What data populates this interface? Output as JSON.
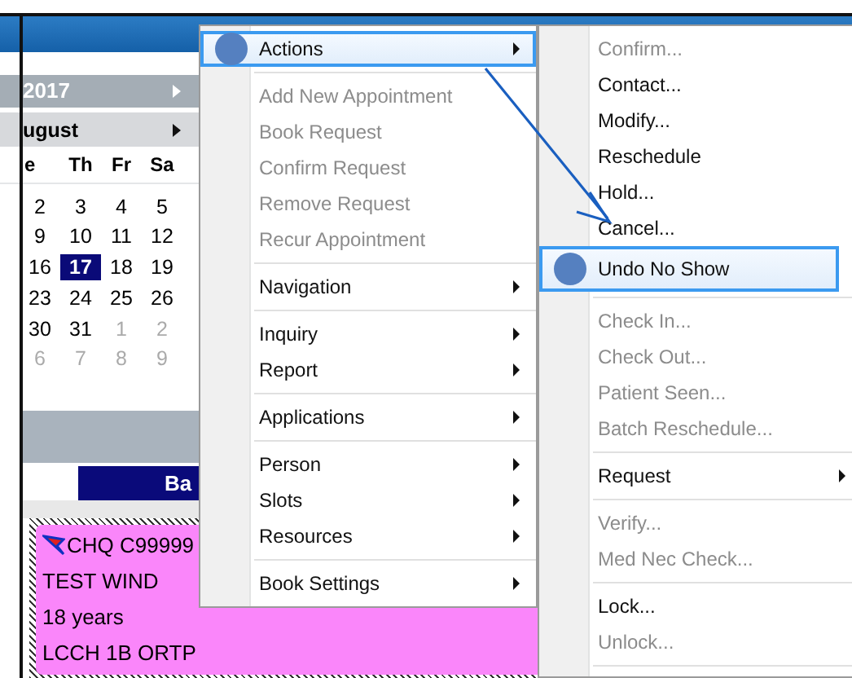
{
  "calendar": {
    "year": "2017",
    "month": "ugust",
    "weekdays": [
      "e",
      "Th",
      "Fr",
      "Sa"
    ],
    "weeks": [
      [
        {
          "day": "2",
          "other_month": false,
          "selected": false
        },
        {
          "day": "3",
          "other_month": false,
          "selected": false
        },
        {
          "day": "4",
          "other_month": false,
          "selected": false
        },
        {
          "day": "5",
          "other_month": false,
          "selected": false
        }
      ],
      [
        {
          "day": "9",
          "other_month": false,
          "selected": false
        },
        {
          "day": "10",
          "other_month": false,
          "selected": false
        },
        {
          "day": "11",
          "other_month": false,
          "selected": false
        },
        {
          "day": "12",
          "other_month": false,
          "selected": false
        }
      ],
      [
        {
          "day": "16",
          "other_month": false,
          "selected": false
        },
        {
          "day": "17",
          "other_month": false,
          "selected": true
        },
        {
          "day": "18",
          "other_month": false,
          "selected": false
        },
        {
          "day": "19",
          "other_month": false,
          "selected": false
        }
      ],
      [
        {
          "day": "23",
          "other_month": false,
          "selected": false
        },
        {
          "day": "24",
          "other_month": false,
          "selected": false
        },
        {
          "day": "25",
          "other_month": false,
          "selected": false
        },
        {
          "day": "26",
          "other_month": false,
          "selected": false
        }
      ],
      [
        {
          "day": "30",
          "other_month": false,
          "selected": false
        },
        {
          "day": "31",
          "other_month": false,
          "selected": false
        },
        {
          "day": "1",
          "other_month": true,
          "selected": false
        },
        {
          "day": "2",
          "other_month": true,
          "selected": false
        }
      ],
      [
        {
          "day": "6",
          "other_month": true,
          "selected": false
        },
        {
          "day": "7",
          "other_month": true,
          "selected": false
        },
        {
          "day": "8",
          "other_month": true,
          "selected": false
        },
        {
          "day": "9",
          "other_month": true,
          "selected": false
        }
      ]
    ]
  },
  "schedule": {
    "column_header": "Ba",
    "appointment": {
      "lines": [
        "CHQ C99999",
        "TEST WIND",
        "18 years",
        "LCCH 1B ORTP"
      ]
    }
  },
  "menus": [
    {
      "items": [
        {
          "kind": "item",
          "label": "Actions",
          "disabled": false,
          "submenu": true,
          "selected": true
        },
        {
          "kind": "separator"
        },
        {
          "kind": "item",
          "label": "Add New Appointment",
          "disabled": true,
          "submenu": false,
          "selected": false
        },
        {
          "kind": "item",
          "label": "Book Request",
          "disabled": true,
          "submenu": false,
          "selected": false
        },
        {
          "kind": "item",
          "label": "Confirm Request",
          "disabled": true,
          "submenu": false,
          "selected": false
        },
        {
          "kind": "item",
          "label": "Remove Request",
          "disabled": true,
          "submenu": false,
          "selected": false
        },
        {
          "kind": "item",
          "label": "Recur Appointment",
          "disabled": true,
          "submenu": false,
          "selected": false
        },
        {
          "kind": "separator"
        },
        {
          "kind": "item",
          "label": "Navigation",
          "disabled": false,
          "submenu": true,
          "selected": false
        },
        {
          "kind": "separator"
        },
        {
          "kind": "item",
          "label": "Inquiry",
          "disabled": false,
          "submenu": true,
          "selected": false
        },
        {
          "kind": "item",
          "label": "Report",
          "disabled": false,
          "submenu": true,
          "selected": false
        },
        {
          "kind": "separator"
        },
        {
          "kind": "item",
          "label": "Applications",
          "disabled": false,
          "submenu": true,
          "selected": false
        },
        {
          "kind": "separator"
        },
        {
          "kind": "item",
          "label": "Person",
          "disabled": false,
          "submenu": true,
          "selected": false
        },
        {
          "kind": "item",
          "label": "Slots",
          "disabled": false,
          "submenu": true,
          "selected": false
        },
        {
          "kind": "item",
          "label": "Resources",
          "disabled": false,
          "submenu": true,
          "selected": false
        },
        {
          "kind": "separator"
        },
        {
          "kind": "item",
          "label": "Book Settings",
          "disabled": false,
          "submenu": true,
          "selected": false
        }
      ]
    },
    {
      "items": [
        {
          "kind": "item",
          "label": "Confirm...",
          "disabled": true,
          "submenu": false,
          "selected": false
        },
        {
          "kind": "item",
          "label": "Contact...",
          "disabled": false,
          "submenu": false,
          "selected": false
        },
        {
          "kind": "item",
          "label": "Modify...",
          "disabled": false,
          "submenu": false,
          "selected": false
        },
        {
          "kind": "item",
          "label": "Reschedule",
          "disabled": false,
          "submenu": false,
          "selected": false
        },
        {
          "kind": "item",
          "label": "Hold...",
          "disabled": false,
          "submenu": false,
          "selected": false
        },
        {
          "kind": "item",
          "label": "Cancel...",
          "disabled": false,
          "submenu": false,
          "selected": false
        },
        {
          "kind": "item",
          "label": "Undo No Show",
          "disabled": false,
          "submenu": false,
          "selected": true
        },
        {
          "kind": "separator"
        },
        {
          "kind": "item",
          "label": "Check In...",
          "disabled": true,
          "submenu": false,
          "selected": false
        },
        {
          "kind": "item",
          "label": "Check Out...",
          "disabled": true,
          "submenu": false,
          "selected": false
        },
        {
          "kind": "item",
          "label": "Patient Seen...",
          "disabled": true,
          "submenu": false,
          "selected": false
        },
        {
          "kind": "item",
          "label": "Batch Reschedule...",
          "disabled": true,
          "submenu": false,
          "selected": false
        },
        {
          "kind": "separator"
        },
        {
          "kind": "item",
          "label": "Request",
          "disabled": false,
          "submenu": true,
          "selected": false
        },
        {
          "kind": "separator"
        },
        {
          "kind": "item",
          "label": "Verify...",
          "disabled": true,
          "submenu": false,
          "selected": false
        },
        {
          "kind": "item",
          "label": "Med Nec Check...",
          "disabled": true,
          "submenu": false,
          "selected": false
        },
        {
          "kind": "separator"
        },
        {
          "kind": "item",
          "label": "Lock...",
          "disabled": false,
          "submenu": false,
          "selected": false
        },
        {
          "kind": "item",
          "label": "Unlock...",
          "disabled": true,
          "submenu": false,
          "selected": false
        },
        {
          "kind": "separator"
        }
      ]
    }
  ]
}
